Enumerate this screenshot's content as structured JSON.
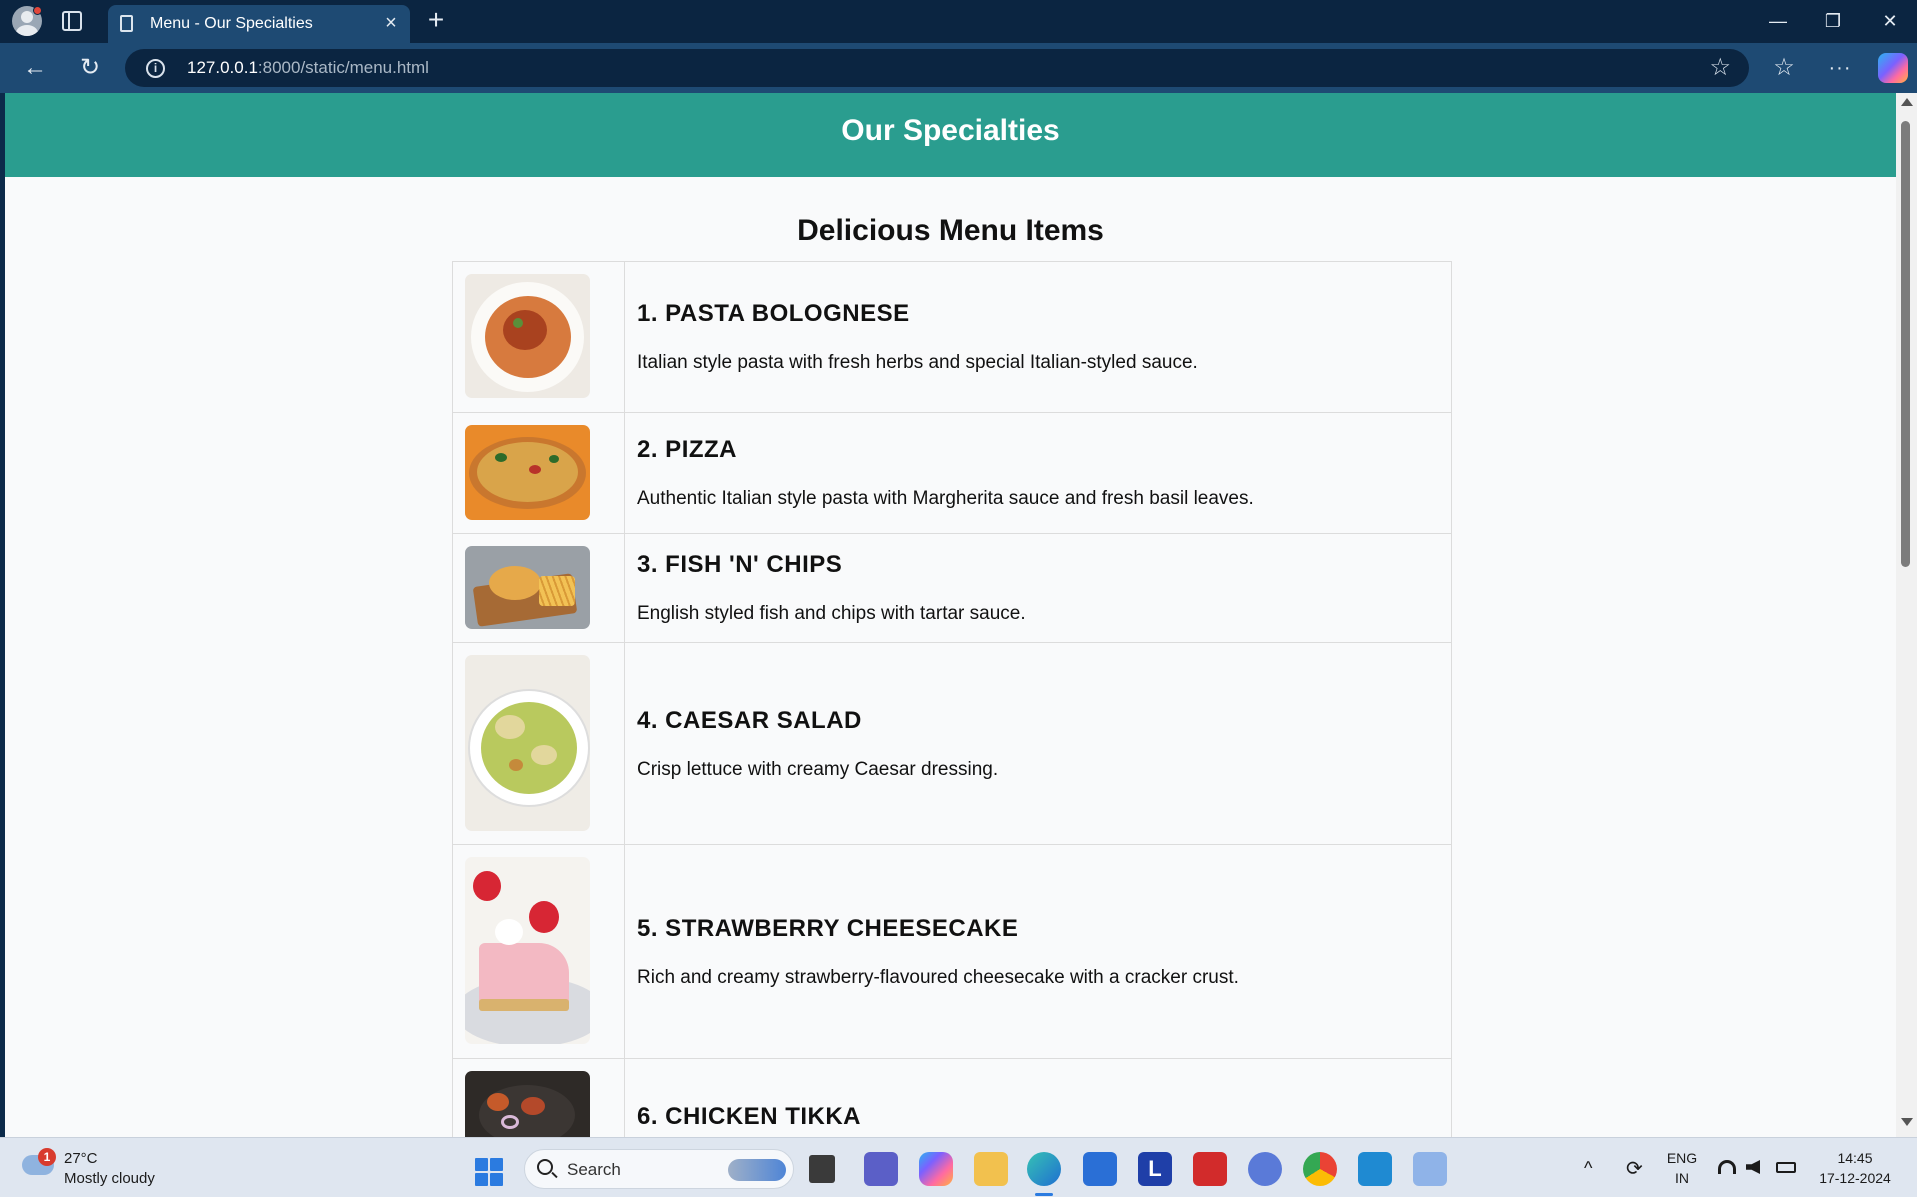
{
  "browser": {
    "tab_title": "Menu - Our Specialties",
    "tab_close": "×",
    "new_tab": "+",
    "url_host": "127.0.0.1",
    "url_path": ":8000/static/menu.html",
    "window_controls": {
      "minimize": "—",
      "restore": "❐",
      "close": "✕"
    },
    "nav": {
      "back": "←",
      "reload": "↻",
      "favorite": "☆",
      "favorites_list": "☆",
      "more": "···"
    },
    "icons": {
      "info": "i",
      "copilot": "copilot-icon"
    }
  },
  "page": {
    "header_title": "Our Specialties",
    "section_title": "Delicious Menu Items",
    "colors": {
      "header": "#2a9d8f",
      "background": "#f9fafb"
    },
    "menu": [
      {
        "name": "1. PASTA BOLOGNESE",
        "description": "Italian style pasta with fresh herbs and special Italian-styled sauce.",
        "image": "pasta-bolognese-photo"
      },
      {
        "name": "2. PIZZA",
        "description": "Authentic Italian style pasta with Margherita sauce and fresh basil leaves.",
        "image": "pizza-photo"
      },
      {
        "name": "3. FISH 'N' CHIPS",
        "description": "English styled fish and chips with tartar sauce.",
        "image": "fish-and-chips-photo"
      },
      {
        "name": "4. CAESAR SALAD",
        "description": "Crisp lettuce with creamy Caesar dressing.",
        "image": "caesar-salad-photo"
      },
      {
        "name": "5. STRAWBERRY CHEESECAKE",
        "description": "Rich and creamy strawberry-flavoured cheesecake with a cracker crust.",
        "image": "strawberry-cheesecake-photo"
      },
      {
        "name": "6. CHICKEN TIKKA",
        "description": "",
        "image": "chicken-tikka-photo"
      }
    ]
  },
  "taskbar": {
    "weather_badge": "1",
    "weather_temp": "27°C",
    "weather_desc": "Mostly cloudy",
    "search_label": "Search",
    "language_top": "ENG",
    "language_bottom": "IN",
    "time": "14:45",
    "date": "17-12-2024",
    "tray": {
      "chevron": "^",
      "sync": "⟳",
      "wifi": "wifi-icon",
      "volume": "volume-icon",
      "battery": "battery-icon"
    },
    "apps": [
      "file-explorer-icon",
      "teams-icon",
      "copilot-icon",
      "folder-icon",
      "edge-icon",
      "store-icon",
      "l-app-icon",
      "mcafee-icon",
      "arc-icon",
      "chrome-icon",
      "vscode-icon",
      "snipping-tool-icon"
    ]
  }
}
